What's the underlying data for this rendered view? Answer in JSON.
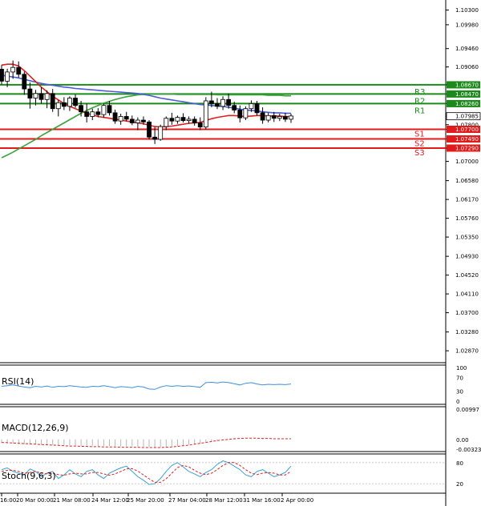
{
  "chart_data": {
    "type": "candlestick",
    "price_axis": {
      "ticks": [
        "1.10300",
        "1.09980",
        "1.09460",
        "1.09060",
        "1.08670",
        "1.08470",
        "1.08260",
        "1.07985",
        "1.07800",
        "1.07700",
        "1.07490",
        "1.07290",
        "1.07000",
        "1.06580",
        "1.06170",
        "1.05760",
        "1.05350",
        "1.04930",
        "1.04520",
        "1.04110",
        "1.03700",
        "1.03280",
        "1.02870"
      ],
      "range": [
        1.0268,
        1.1038
      ]
    },
    "time_axis": {
      "labels": [
        "16:00",
        "20 Mar 00:00",
        "21 Mar 08:00",
        "24 Mar 12:00",
        "25 Mar 20:00",
        "27 Mar 04:00",
        "28 Mar 12:00",
        "31 Mar 16:00",
        "2 Apr 00:00"
      ]
    },
    "current_price": "1.07985",
    "levels": [
      {
        "name": "R3",
        "value": "1.08670",
        "price": 1.0867,
        "color": "#1a8a1a"
      },
      {
        "name": "R2",
        "value": "1.08470",
        "price": 1.0847,
        "color": "#1a8a1a"
      },
      {
        "name": "R1",
        "value": "1.08260",
        "price": 1.0826,
        "color": "#1a8a1a"
      },
      {
        "name": "S1",
        "value": "1.07700",
        "price": 1.077,
        "color": "#e21a1a"
      },
      {
        "name": "S2",
        "value": "1.07490",
        "price": 1.0749,
        "color": "#e21a1a"
      },
      {
        "name": "S3",
        "value": "1.07290",
        "price": 1.0729,
        "color": "#e21a1a"
      }
    ],
    "candles": [
      [
        1.0901,
        1.091,
        1.0868,
        1.0875
      ],
      [
        1.0875,
        1.0902,
        1.0862,
        1.0895
      ],
      [
        1.0895,
        1.092,
        1.088,
        1.0905
      ],
      [
        1.0905,
        1.0918,
        1.0883,
        1.089
      ],
      [
        1.089,
        1.0896,
        1.0845,
        1.0858
      ],
      [
        1.0858,
        1.0872,
        1.0815,
        1.0838
      ],
      [
        1.0838,
        1.0856,
        1.0822,
        1.0848
      ],
      [
        1.0848,
        1.0862,
        1.0826,
        1.0835
      ],
      [
        1.0835,
        1.0855,
        1.0816,
        1.0848
      ],
      [
        1.0848,
        1.0858,
        1.0808,
        1.0815
      ],
      [
        1.0815,
        1.0834,
        1.0798,
        1.0828
      ],
      [
        1.0828,
        1.084,
        1.0812,
        1.082
      ],
      [
        1.082,
        1.0842,
        1.081,
        1.0838
      ],
      [
        1.0838,
        1.0846,
        1.0817,
        1.0822
      ],
      [
        1.0822,
        1.0832,
        1.0798,
        1.0808
      ],
      [
        1.0808,
        1.0826,
        1.0785,
        1.0798
      ],
      [
        1.0798,
        1.0815,
        1.079,
        1.0808
      ],
      [
        1.0808,
        1.0816,
        1.0796,
        1.0802
      ],
      [
        1.0802,
        1.0826,
        1.0795,
        1.0822
      ],
      [
        1.0822,
        1.0832,
        1.08,
        1.0806
      ],
      [
        1.0806,
        1.0813,
        1.0782,
        1.0788
      ],
      [
        1.0788,
        1.0804,
        1.078,
        1.0798
      ],
      [
        1.0798,
        1.0808,
        1.0788,
        1.0792
      ],
      [
        1.0792,
        1.08,
        1.0779,
        1.0784
      ],
      [
        1.0784,
        1.0796,
        1.0768,
        1.079
      ],
      [
        1.079,
        1.0798,
        1.078,
        1.0786
      ],
      [
        1.0786,
        1.079,
        1.0748,
        1.0753
      ],
      [
        1.0753,
        1.0775,
        1.0738,
        1.0748
      ],
      [
        1.0748,
        1.078,
        1.0745,
        1.0776
      ],
      [
        1.0776,
        1.0798,
        1.0768,
        1.0794
      ],
      [
        1.0794,
        1.0806,
        1.078,
        1.0788
      ],
      [
        1.0788,
        1.08,
        1.0782,
        1.0796
      ],
      [
        1.0796,
        1.0805,
        1.0785,
        1.0789
      ],
      [
        1.0789,
        1.0798,
        1.0782,
        1.0792
      ],
      [
        1.0792,
        1.0798,
        1.0778,
        1.0784
      ],
      [
        1.0784,
        1.0796,
        1.0768,
        1.0775
      ],
      [
        1.0775,
        1.084,
        1.077,
        1.0832
      ],
      [
        1.0832,
        1.0852,
        1.0818,
        1.0826
      ],
      [
        1.0826,
        1.0838,
        1.0814,
        1.082
      ],
      [
        1.082,
        1.0842,
        1.0812,
        1.0835
      ],
      [
        1.0835,
        1.0848,
        1.0815,
        1.0822
      ],
      [
        1.0822,
        1.083,
        1.0805,
        1.0812
      ],
      [
        1.0812,
        1.0822,
        1.0785,
        1.0795
      ],
      [
        1.0795,
        1.082,
        1.079,
        1.0815
      ],
      [
        1.0815,
        1.0833,
        1.0808,
        1.0826
      ],
      [
        1.0826,
        1.0832,
        1.08,
        1.0806
      ],
      [
        1.0806,
        1.0818,
        1.0782,
        1.079
      ],
      [
        1.079,
        1.0806,
        1.0785,
        1.08
      ],
      [
        1.08,
        1.0808,
        1.0786,
        1.0794
      ],
      [
        1.0794,
        1.0804,
        1.0788,
        1.0798
      ],
      [
        1.0798,
        1.0806,
        1.0786,
        1.0792
      ],
      [
        1.0792,
        1.0804,
        1.0784,
        1.0799
      ]
    ],
    "ma_red": [
      1.091,
      1.0912,
      1.0912,
      1.0908,
      1.0898,
      1.0886,
      1.0874,
      1.0862,
      1.0852,
      1.0842,
      1.0834,
      1.0826,
      1.082,
      1.0815,
      1.081,
      1.0805,
      1.0801,
      1.0798,
      1.0796,
      1.0794,
      1.0792,
      1.079,
      1.0788,
      1.0786,
      1.0784,
      1.0782,
      1.0779,
      1.0776,
      1.0775,
      1.0776,
      1.0777,
      1.0779,
      1.0781,
      1.0783,
      1.0784,
      1.0785,
      1.0789,
      1.0793,
      1.0796,
      1.0798,
      1.08,
      1.08,
      1.0799,
      1.0798,
      1.0799,
      1.08,
      1.08,
      1.0799,
      1.0799,
      1.0799,
      1.0798,
      1.0798
    ],
    "ma_blue": [
      1.0888,
      1.0886,
      1.0884,
      1.0882,
      1.0879,
      1.0876,
      1.0873,
      1.087,
      1.0868,
      1.0866,
      1.0864,
      1.0862,
      1.0861,
      1.0859,
      1.0858,
      1.0857,
      1.0856,
      1.0855,
      1.0854,
      1.0853,
      1.0852,
      1.0851,
      1.085,
      1.0849,
      1.0848,
      1.0846,
      1.0844,
      1.0841,
      1.0838,
      1.0836,
      1.0834,
      1.0832,
      1.083,
      1.0828,
      1.0826,
      1.0824,
      1.0823,
      1.0822,
      1.0821,
      1.082,
      1.0818,
      1.0816,
      1.0814,
      1.0812,
      1.0811,
      1.081,
      1.0808,
      1.0807,
      1.0806,
      1.0806,
      1.0805,
      1.0805
    ],
    "ma_green": [
      1.0708,
      1.0714,
      1.072,
      1.0727,
      1.0734,
      1.0741,
      1.0748,
      1.0756,
      1.0763,
      1.077,
      1.0777,
      1.0784,
      1.0791,
      1.0798,
      1.0805,
      1.0811,
      1.0817,
      1.0822,
      1.0827,
      1.0831,
      1.0835,
      1.0838,
      1.0841,
      1.0843,
      1.0845,
      1.0846,
      1.0847,
      1.0847,
      1.0847,
      1.0847,
      1.0847,
      1.0846,
      1.0846,
      1.0846,
      1.0846,
      1.0846,
      1.0846,
      1.0846,
      1.0845,
      1.0845,
      1.0845,
      1.0845,
      1.0845,
      1.0845,
      1.0845,
      1.0845,
      1.0845,
      1.0844,
      1.0844,
      1.0844,
      1.0843,
      1.0843
    ],
    "rsi": {
      "label": "RSI(14)",
      "ticks": [
        "100",
        "70",
        "30",
        "0"
      ],
      "values": [
        44,
        46,
        48,
        45,
        42,
        40,
        44,
        42,
        45,
        41,
        44,
        43,
        46,
        44,
        42,
        41,
        44,
        43,
        46,
        43,
        40,
        43,
        42,
        40,
        44,
        42,
        36,
        35,
        42,
        46,
        44,
        46,
        44,
        45,
        43,
        41,
        55,
        56,
        54,
        57,
        55,
        52,
        48,
        53,
        55,
        51,
        48,
        50,
        49,
        50,
        49,
        51
      ]
    },
    "macd": {
      "label": "MACD(12,26,9)",
      "ticks": [
        "0.00997",
        "0.00",
        "-0.00323"
      ],
      "histogram": [
        -0.0012,
        -0.0013,
        -0.0014,
        -0.0015,
        -0.0016,
        -0.0017,
        -0.0017,
        -0.0018,
        -0.0018,
        -0.0019,
        -0.0019,
        -0.002,
        -0.002,
        -0.002,
        -0.0021,
        -0.0021,
        -0.0021,
        -0.0022,
        -0.0022,
        -0.0022,
        -0.0022,
        -0.0023,
        -0.0023,
        -0.0023,
        -0.0024,
        -0.0024,
        -0.0025,
        -0.0026,
        -0.0026,
        -0.0025,
        -0.0024,
        -0.0022,
        -0.002,
        -0.0018,
        -0.0016,
        -0.0014,
        -0.001,
        -0.0007,
        -0.0005,
        -0.0003,
        -0.0002,
        -0.0001,
        -0.0001,
        0.0,
        0.0001,
        0.0001,
        0.0001,
        0.0,
        0.0,
        0.0,
        0.0,
        0.0
      ],
      "signal": [
        -0.001,
        -0.0011,
        -0.0012,
        -0.0013,
        -0.0014,
        -0.0015,
        -0.0016,
        -0.0017,
        -0.0018,
        -0.0019,
        -0.002,
        -0.0021,
        -0.0022,
        -0.0022,
        -0.0023,
        -0.0023,
        -0.0024,
        -0.0024,
        -0.0025,
        -0.0025,
        -0.0025,
        -0.0026,
        -0.0026,
        -0.0026,
        -0.0026,
        -0.0027,
        -0.0027,
        -0.0027,
        -0.0027,
        -0.0026,
        -0.0025,
        -0.0023,
        -0.0021,
        -0.0019,
        -0.0016,
        -0.0013,
        -0.001,
        -0.0007,
        -0.0004,
        -0.0002,
        0.0,
        0.0002,
        0.0003,
        0.0004,
        0.0004,
        0.0004,
        0.0003,
        0.0003,
        0.0002,
        0.0002,
        0.0002,
        0.0002
      ]
    },
    "stoch": {
      "label": "Stoch(9,6,3)",
      "ticks": [
        "80",
        "20"
      ],
      "main": [
        60,
        65,
        55,
        50,
        45,
        62,
        55,
        40,
        50,
        55,
        35,
        45,
        60,
        48,
        40,
        55,
        60,
        45,
        35,
        50,
        58,
        65,
        70,
        55,
        40,
        30,
        18,
        20,
        35,
        55,
        72,
        80,
        68,
        55,
        48,
        40,
        52,
        60,
        75,
        85,
        80,
        70,
        60,
        45,
        40,
        55,
        60,
        50,
        40,
        45,
        52,
        70
      ],
      "signal": [
        55,
        58,
        58,
        55,
        50,
        52,
        55,
        50,
        48,
        50,
        46,
        44,
        48,
        50,
        48,
        48,
        52,
        52,
        48,
        44,
        48,
        55,
        62,
        63,
        56,
        45,
        34,
        24,
        24,
        34,
        50,
        66,
        72,
        68,
        58,
        50,
        46,
        50,
        60,
        72,
        80,
        80,
        72,
        60,
        50,
        46,
        50,
        52,
        50,
        45,
        45,
        55
      ]
    }
  }
}
